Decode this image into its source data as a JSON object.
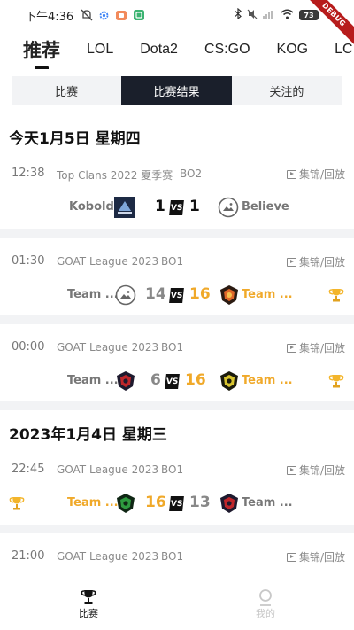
{
  "status_bar": {
    "time": "下午4:36",
    "battery": "73",
    "debug": "DEBUG"
  },
  "top_tabs": [
    "推荐",
    "LOL",
    "Dota2",
    "CS:GO",
    "KOG",
    "LC"
  ],
  "segments": [
    "比赛",
    "比赛结果",
    "关注的"
  ],
  "dates": [
    "今天1月5日 星期四",
    "2023年1月4日 星期三"
  ],
  "replay_label": "集锦/回放",
  "vs_label": "VS",
  "matches": [
    {
      "time": "12:38",
      "league": "Top Clans 2022 夏季赛",
      "bo": "BO2",
      "team_a": "Kobolds",
      "score_a": "1",
      "score_b": "1",
      "team_b": "Believe"
    },
    {
      "time": "01:30",
      "league": "GOAT League 2023",
      "bo": "BO1",
      "team_a": "Team ...",
      "score_a": "14",
      "score_b": "16",
      "team_b": "Team ..."
    },
    {
      "time": "00:00",
      "league": "GOAT League 2023",
      "bo": "BO1",
      "team_a": "Team ...",
      "score_a": "6",
      "score_b": "16",
      "team_b": "Team ..."
    },
    {
      "time": "22:45",
      "league": "GOAT League 2023",
      "bo": "BO1",
      "team_a": "Team ...",
      "score_a": "16",
      "score_b": "13",
      "team_b": "Team ..."
    },
    {
      "time": "21:00",
      "league": "GOAT League 2023",
      "bo": "BO1"
    }
  ],
  "bottom_nav": {
    "matches": "比赛",
    "mine": "我的"
  },
  "colors": {
    "win": "#f0a92a",
    "active_segment": "#1a1f2b"
  }
}
